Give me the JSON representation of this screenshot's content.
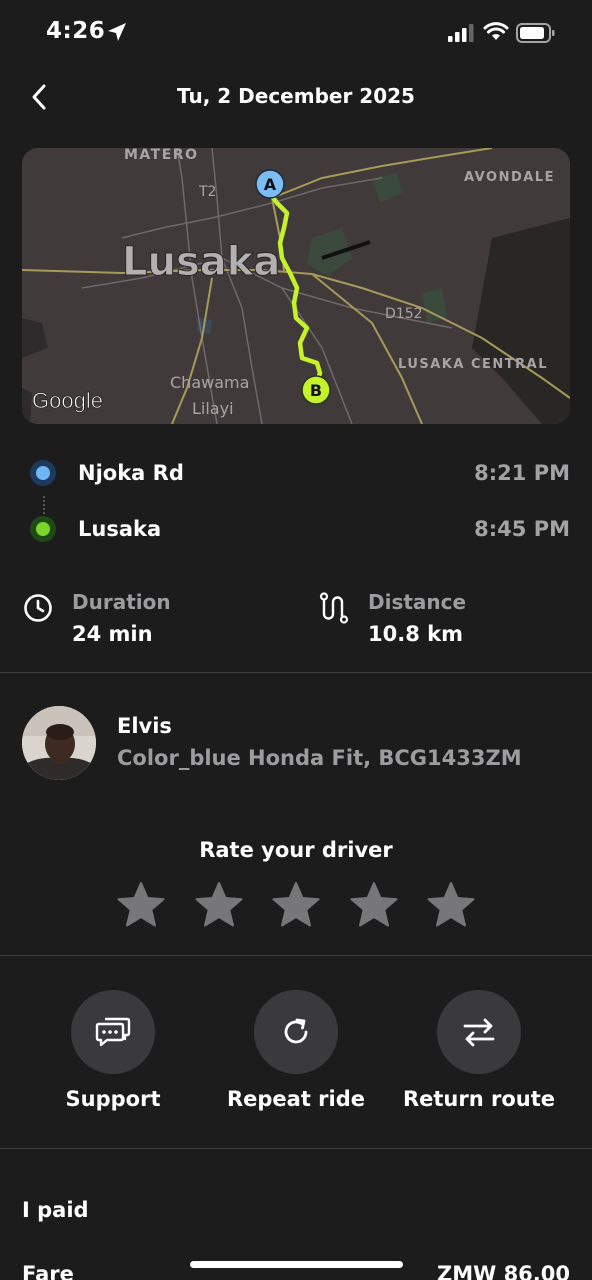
{
  "status_bar": {
    "time": "4:26"
  },
  "header": {
    "title": "Tu, 2 December 2025"
  },
  "map": {
    "labels": {
      "matero": "MATERO",
      "avondale": "AVONDALE",
      "t2": "T2",
      "city": "Lusaka",
      "d152": "D152",
      "lusaka_central": "LUSAKA CENTRAL",
      "chawama": "Chawama",
      "lilayi": "Lilayi"
    },
    "marker_a": "A",
    "marker_b": "B",
    "logo": "Google",
    "route_color": "#c6f22a"
  },
  "trip": {
    "stops": [
      {
        "name": "Njoka Rd",
        "time": "8:21 PM",
        "color": "#6fb6f5"
      },
      {
        "name": "Lusaka",
        "time": "8:45 PM",
        "color": "#7bd62a"
      }
    ],
    "duration": {
      "label": "Duration",
      "value": "24 min",
      "icon": "clock-icon"
    },
    "distance": {
      "label": "Distance",
      "value": "10.8 km",
      "icon": "route-icon"
    }
  },
  "driver": {
    "name": "Elvis",
    "car": "Color_blue Honda Fit, BCG1433ZM"
  },
  "rating": {
    "title": "Rate your driver",
    "stars_total": 5,
    "stars_selected": 0
  },
  "actions": [
    {
      "label": "Support",
      "icon": "chat-icon"
    },
    {
      "label": "Repeat ride",
      "icon": "refresh-icon"
    },
    {
      "label": "Return route",
      "icon": "swap-arrows-icon"
    }
  ],
  "payment": {
    "title": "I paid",
    "fare_label": "Fare",
    "fare_value": "ZMW 86.00"
  }
}
